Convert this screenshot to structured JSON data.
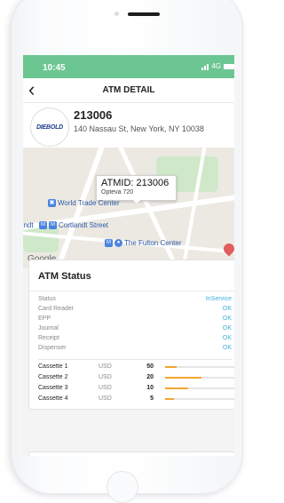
{
  "status_bar": {
    "time": "10:45",
    "network": "4G"
  },
  "nav": {
    "back_icon": "chevron-left-icon",
    "title": "ATM DETAIL"
  },
  "atm": {
    "logo_text": "DIEBOLD",
    "id": "213006",
    "address": "140 Nassau St, New York, NY 10038"
  },
  "map": {
    "callout_id": "ATMID: 213006",
    "callout_model": "Opteva 720",
    "labels": {
      "world_trade": "World Trade Center",
      "cortlandt": "Cortlandt Street",
      "fulton": "The Fulton Center",
      "cut_left": "andt",
      "google": "Google"
    }
  },
  "status_card": {
    "title": "ATM Status",
    "rows": [
      {
        "label": "Status",
        "value": "InService"
      },
      {
        "label": "Card Reader",
        "value": "OK"
      },
      {
        "label": "EPP",
        "value": "OK"
      },
      {
        "label": "Journal",
        "value": "OK"
      },
      {
        "label": "Receipt",
        "value": "OK"
      },
      {
        "label": "Dispenser",
        "value": "OK"
      }
    ],
    "cassettes": [
      {
        "name": "Cassette 1",
        "currency": "USD",
        "count": "50",
        "level": 0.15
      },
      {
        "name": "Cassette 2",
        "currency": "USD",
        "count": "20",
        "level": 0.48
      },
      {
        "name": "Cassette 3",
        "currency": "USD",
        "count": "10",
        "level": 0.3
      },
      {
        "name": "Cassette 4",
        "currency": "USD",
        "count": "5",
        "level": 0.12
      }
    ]
  },
  "colors": {
    "header_green": "#6cc691",
    "ok_blue": "#3bb0d8",
    "bar_orange": "#f2a531"
  }
}
